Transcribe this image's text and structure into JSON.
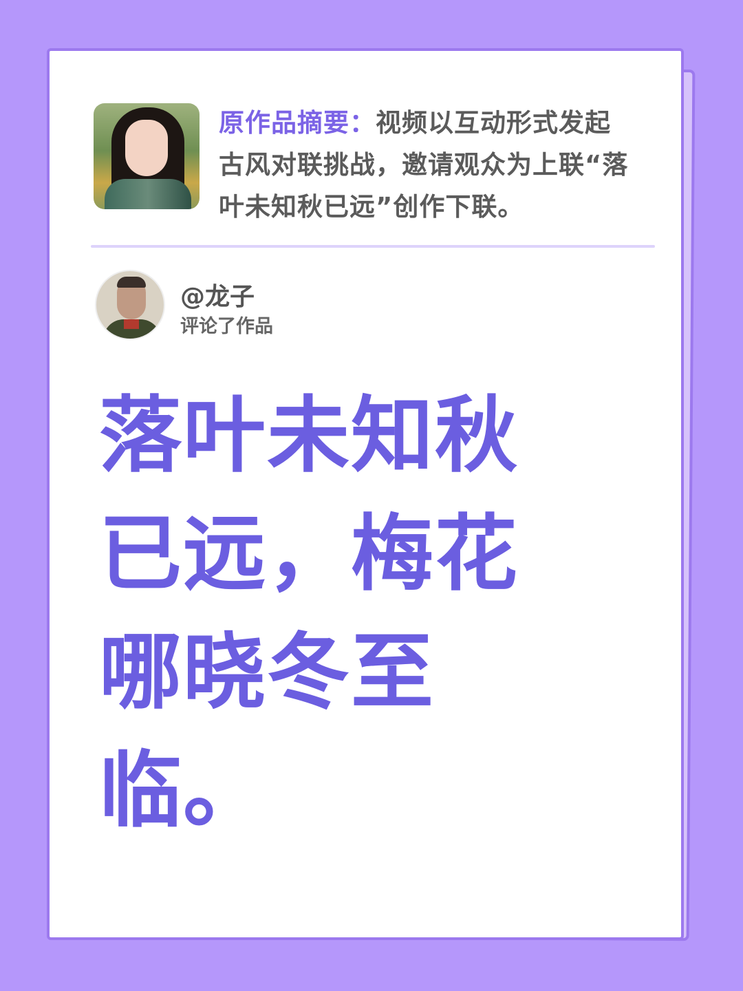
{
  "summary": {
    "label": "原作品摘要：",
    "text": "视频以互动形式发起古风对联挑战，邀请观众为上联“落叶未知秋已远”创作下联。"
  },
  "commenter": {
    "name": "@龙子",
    "action": "评论了作品"
  },
  "comment": {
    "text": "落叶未知秋已远，梅花哪晓冬至临。"
  },
  "colors": {
    "background": "#b597fb",
    "accent": "#6b5ee0",
    "label": "#7b63e6",
    "body_text": "#5b5b5b"
  }
}
